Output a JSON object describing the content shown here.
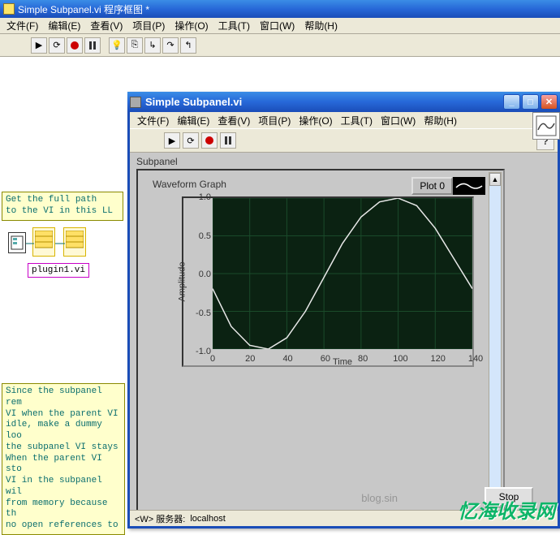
{
  "outer": {
    "title": "Simple Subpanel.vi 程序框图 *",
    "menus": [
      "文件(F)",
      "编辑(E)",
      "查看(V)",
      "项目(P)",
      "操作(O)",
      "工具(T)",
      "窗口(W)",
      "帮助(H)"
    ]
  },
  "comment1": "Get the full path\nto the VI in this LL",
  "plugin_label": "plugin1.vi",
  "comment2": "Since the subpanel rem\nVI when the parent VI\nidle, make a dummy loo\nthe subpanel VI stays\nWhen the parent VI sto\nVI in the subpanel wil\nfrom memory because th\nno open references to",
  "inner": {
    "title": "Simple Subpanel.vi",
    "menus": [
      "文件(F)",
      "编辑(E)",
      "查看(V)",
      "项目(P)",
      "操作(O)",
      "工具(T)",
      "窗口(W)",
      "帮助(H)"
    ],
    "help_btn": "?",
    "subpanel_label": "Subpanel",
    "graph_title": "Waveform Graph",
    "legend_label": "Plot 0",
    "ylabel": "Amplitude",
    "xlabel": "Time",
    "stop_btn": "Stop",
    "status_prefix": "<W> 服务器:",
    "status_server": "localhost"
  },
  "chart_data": {
    "type": "line",
    "title": "Waveform Graph",
    "xlabel": "Time",
    "ylabel": "Amplitude",
    "xlim": [
      0,
      140
    ],
    "ylim": [
      -1.0,
      1.0
    ],
    "xticks": [
      0,
      20,
      40,
      60,
      80,
      100,
      120,
      140
    ],
    "yticks": [
      -1.0,
      -0.5,
      0.0,
      0.5,
      1.0
    ],
    "series": [
      {
        "name": "Plot 0",
        "x": [
          0,
          10,
          20,
          30,
          40,
          50,
          60,
          70,
          80,
          90,
          100,
          110,
          120,
          130,
          140
        ],
        "y": [
          -0.2,
          -0.7,
          -0.95,
          -1.0,
          -0.85,
          -0.5,
          -0.05,
          0.4,
          0.75,
          0.95,
          1.0,
          0.9,
          0.6,
          0.2,
          -0.2
        ]
      }
    ]
  },
  "watermark1": "blog.sin",
  "watermark2": "忆海收录网"
}
